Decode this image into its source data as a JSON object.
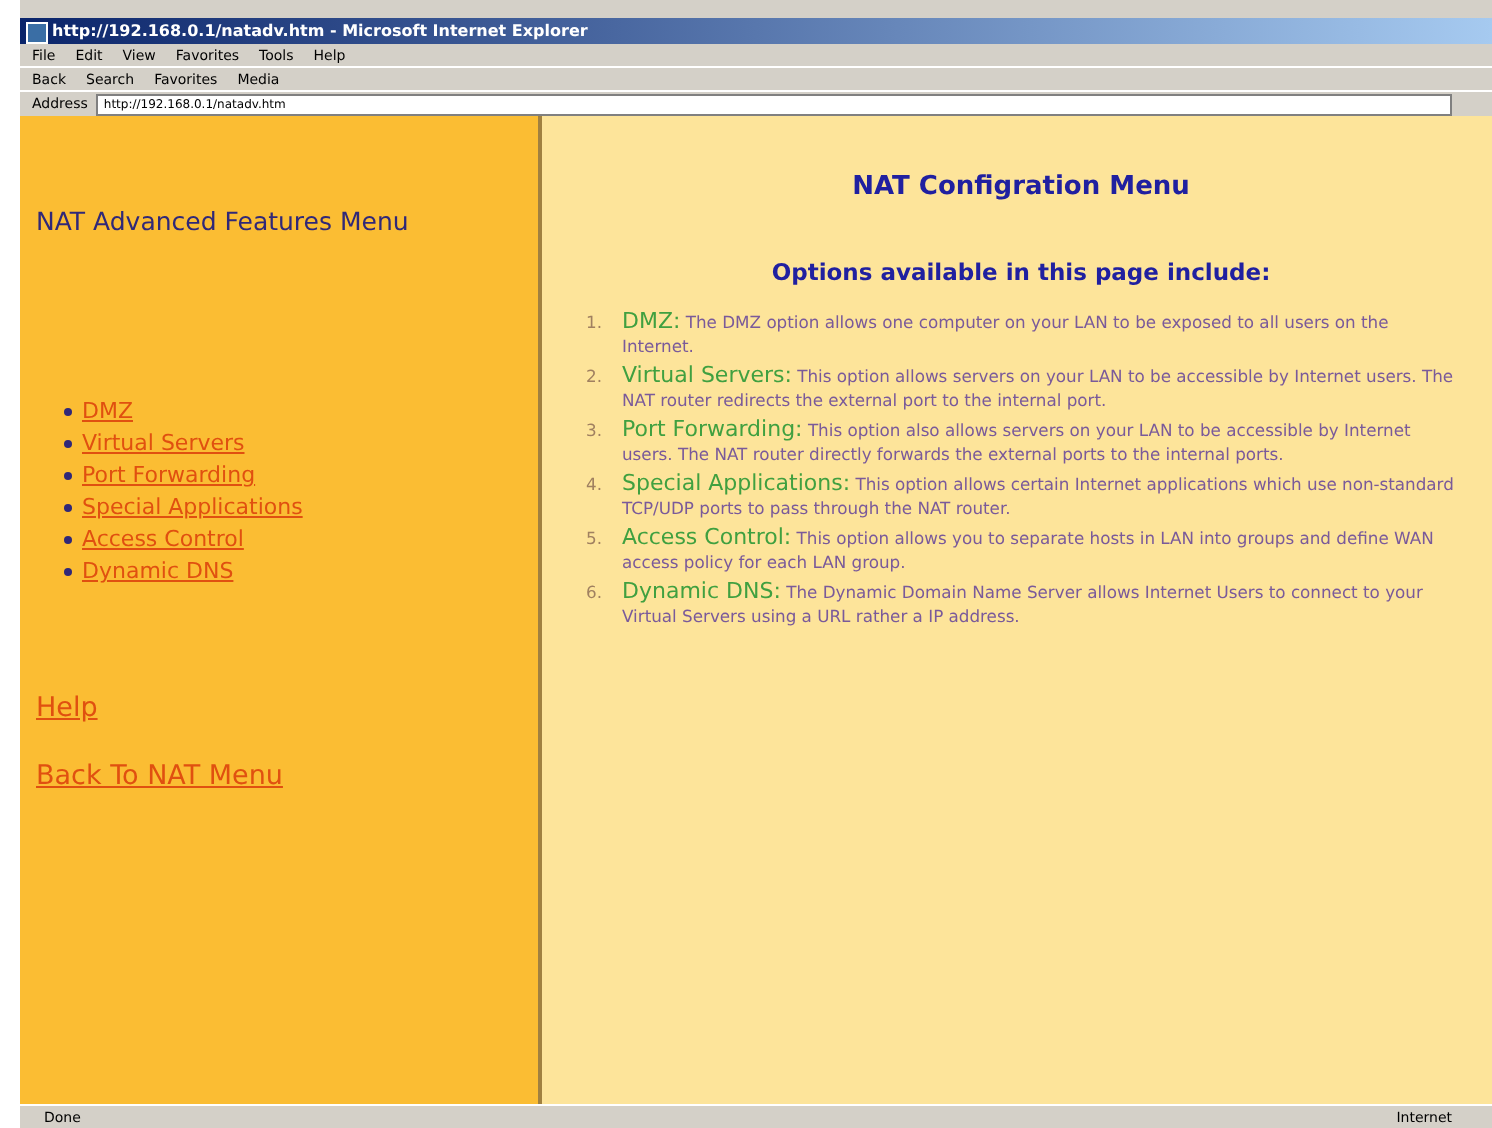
{
  "window": {
    "title": "http://192.168.0.1/natadv.htm - Microsoft Internet Explorer"
  },
  "menu": [
    "File",
    "Edit",
    "View",
    "Favorites",
    "Tools",
    "Help"
  ],
  "toolbar": [
    "Back",
    "Search",
    "Favorites",
    "Media"
  ],
  "address": {
    "label": "Address",
    "value": "http://192.168.0.1/natadv.htm"
  },
  "sidebar": {
    "title": "NAT Advanced Features Menu",
    "items": [
      "DMZ",
      "Virtual Servers",
      "Port Forwarding",
      "Special Applications",
      "Access Control",
      "Dynamic DNS"
    ],
    "links": [
      "Help",
      "Back To NAT Menu"
    ]
  },
  "content": {
    "title": "NAT Configration Menu",
    "subtitle": "Options available in this page include:",
    "options": [
      {
        "number": "1.",
        "name": "DMZ:",
        "text": "The DMZ option allows one computer on your LAN to be exposed to all users on the Internet."
      },
      {
        "number": "2.",
        "name": "Virtual Servers:",
        "text": "This option allows servers on your LAN to be accessible by Internet users. The NAT router redirects the external port to the internal port."
      },
      {
        "number": "3.",
        "name": "Port Forwarding:",
        "text": "This option also allows servers on your LAN to be accessible by Internet users. The NAT router directly forwards the external ports to the internal ports."
      },
      {
        "number": "4.",
        "name": "Special Applications:",
        "text": "This option allows certain Internet applications which use non-standard TCP/UDP ports to pass through the NAT router."
      },
      {
        "number": "5.",
        "name": "Access Control:",
        "text": "This option allows you to separate hosts in LAN into groups and define WAN access policy for each LAN group."
      },
      {
        "number": "6.",
        "name": "Dynamic DNS:",
        "text": "The Dynamic Domain Name Server allows Internet Users to connect to your Virtual Servers using a URL rather a IP address."
      }
    ]
  },
  "status_bar": {
    "left": "Done",
    "zone": "Internet"
  }
}
